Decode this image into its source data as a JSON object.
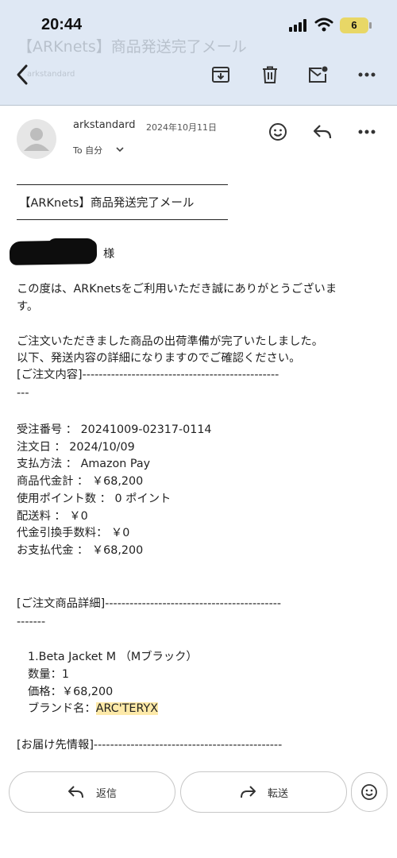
{
  "status_bar": {
    "time": "20:44",
    "battery": "6"
  },
  "toolbar_ghost": {
    "subject": "【ARKnets】商品発送完了メール",
    "from": "arkstandard"
  },
  "header": {
    "sender": "arkstandard",
    "date": "2024年10月11日",
    "to_label": "To 自分"
  },
  "email": {
    "subject": "【ARKnets】商品発送完了メール",
    "salutation": "様",
    "lines": {
      "intro1": "この度は、ARKnetsをご利用いただき誠にありがとうございま",
      "intro2": "す。",
      "ready": "ご注文いただきました商品の出荷準備が完了いたしました。",
      "below": "以下、発送内容の詳細になりますのでご確認ください。",
      "order_sec1": "[ご注文内容]------------------------------------------------",
      "order_sec2": "---",
      "order_no": "受注番号 ： 20241009-02317-0114",
      "order_date": "注文日 ： 2024/10/09",
      "payment": "支払方法 ： Amazon Pay",
      "subtotal": "商品代金計 ： ￥68,200",
      "points": "使用ポイント数 ： 0 ポイント",
      "shipping": "配送料 ： ￥0",
      "cod_fee": "代金引換手数料： ￥0",
      "total": "お支払代金 ： ￥68,200",
      "detail_sec1": "[ご注文商品詳細]-------------------------------------------",
      "detail_sec2": "-------",
      "item": "1.Beta Jacket M （Mブラック）",
      "qty": "数量：1",
      "price": "価格：￥68,200",
      "brand_label": "ブランド名：",
      "brand_value": "ARC'TERYX",
      "delivery_sec": "[お届け先情報]----------------------------------------------"
    }
  },
  "actions": {
    "reply": "返信",
    "forward": "転送"
  }
}
